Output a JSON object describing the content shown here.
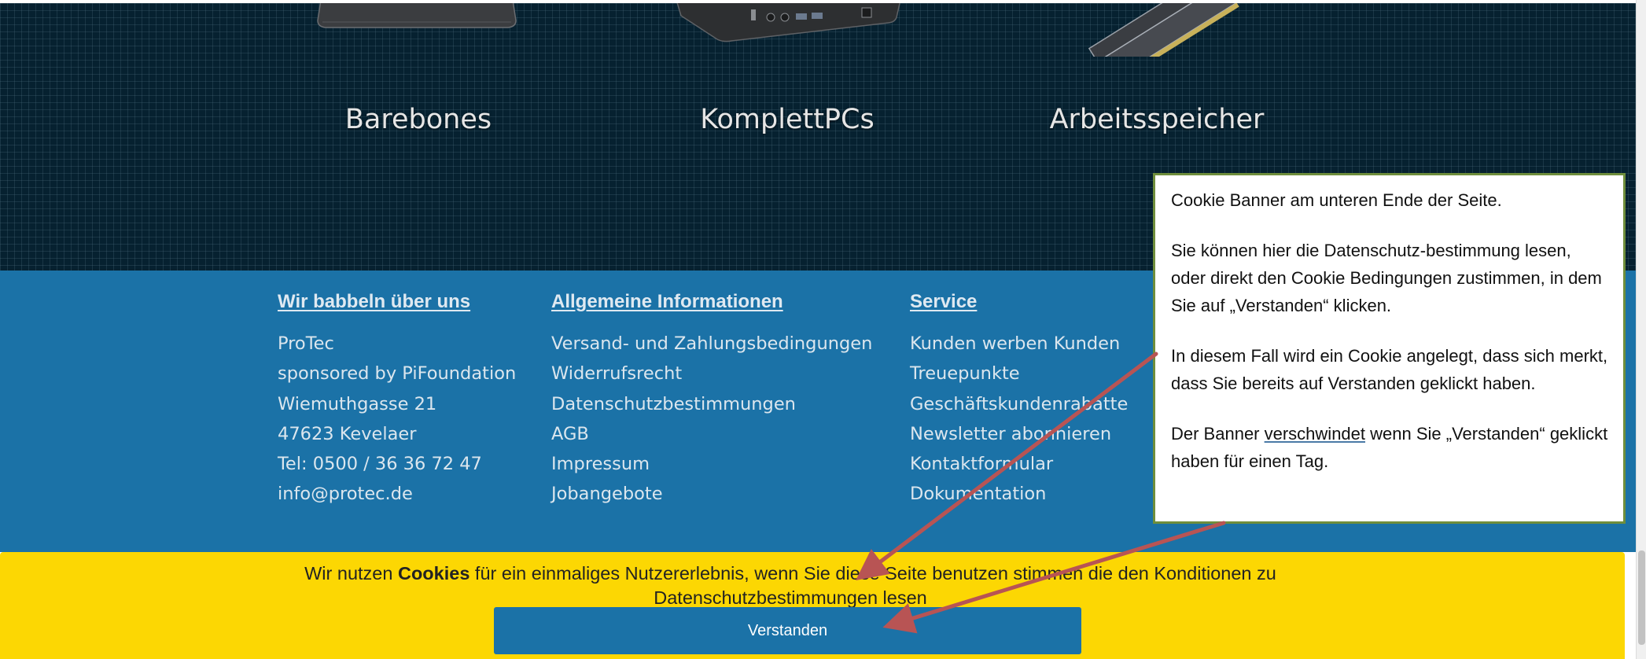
{
  "categories": [
    {
      "title": "Barebones"
    },
    {
      "title": "KomplettPCs"
    },
    {
      "title": "Arbeitsspeicher"
    }
  ],
  "footer": {
    "col1": {
      "heading": "Wir babbeln über uns",
      "items": [
        "ProTec",
        "sponsored by PiFoundation",
        "Wiemuthgasse 21",
        "47623 Kevelaer",
        "Tel: 0500 / 36 36 72 47",
        "info@protec.de"
      ]
    },
    "col2": {
      "heading": "Allgemeine Informationen",
      "items": [
        "Versand- und Zahlungsbedingungen",
        "Widerrufsrecht",
        "Datenschutzbestimmungen",
        "AGB",
        "Impressum",
        "Jobangebote"
      ]
    },
    "col3": {
      "heading": "Service",
      "items": [
        "Kunden werben Kunden",
        "Treuepunkte",
        "Geschäftskundenrabatte",
        "Newsletter abonnieren",
        "Kontaktformular",
        "Dokumentation"
      ]
    }
  },
  "cookie": {
    "text_before": "Wir nutzen ",
    "text_bold": "Cookies",
    "text_after": " für ein einmaliges Nutzererlebnis, wenn Sie diese Seite benutzen stimmen die den Konditionen zu",
    "link_text": "Datenschutzbestimmungen lesen",
    "button_label": "Verstanden"
  },
  "annotation": {
    "p1": "Cookie Banner am unteren Ende der Seite.",
    "p2": "Sie können hier die Datenschutz-bestimmung lesen, oder direkt den Cookie Bedingungen zustimmen, in dem Sie auf „Verstanden“ klicken.",
    "p3": "In diesem Fall wird ein Cookie angelegt, dass sich merkt, dass Sie bereits auf Verstanden geklickt haben.",
    "p4_before": "Der Banner ",
    "p4_underlined": "verschwindet",
    "p4_after": " wenn Sie „Verstanden“ geklickt haben für einen Tag."
  },
  "colors": {
    "hero_bg": "#062130",
    "footer_bg": "#1b72a7",
    "banner_bg": "#fcd703",
    "button_bg": "#1b72a7",
    "arrow": "#b85454",
    "note_border": "#6f8e3c"
  },
  "icons": [
    "barebone-pc-image",
    "komplett-pc-image",
    "ram-module-image",
    "callout-arrow"
  ]
}
